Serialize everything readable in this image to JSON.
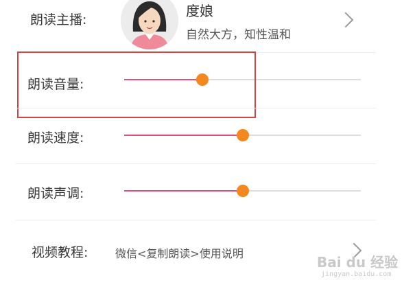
{
  "anchor": {
    "label": "朗读主播:",
    "name": "度娘",
    "description": "自然大方，知性温和"
  },
  "volume": {
    "label": "朗读音量:",
    "level": 0.33
  },
  "speed": {
    "label": "朗读速度:",
    "level": 0.5
  },
  "pitch": {
    "label": "朗读声调:",
    "level": 0.5
  },
  "tutorial": {
    "label": "视频教程:",
    "value": "微信<复制朗读>使用说明"
  },
  "watermark": {
    "logo_text": "Bai du 经验",
    "url_text": "jingyan.baidu.com"
  },
  "colors": {
    "slider_fill": "#e3517a",
    "slider_thumb": "#f5871f",
    "highlight_box": "#d64545"
  },
  "icons": {
    "avatar": "female-avatar",
    "chevron": "chevron-right-icon"
  }
}
